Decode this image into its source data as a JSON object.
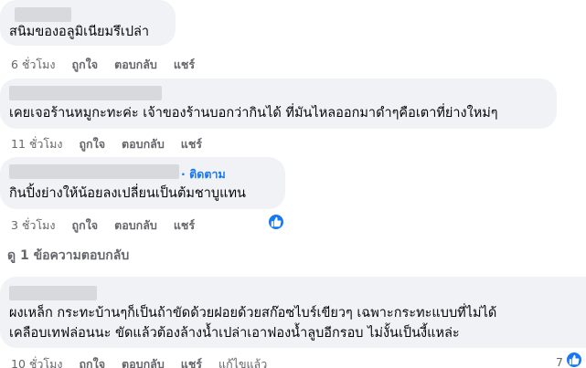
{
  "comments": [
    {
      "text": "สนิมของอลูมิเนียมรึเปล่า",
      "time": "6 ชั่วโมง",
      "like": "ถูกใจ",
      "reply": "ตอบกลับ",
      "share": "แชร์"
    },
    {
      "text": "เคยเจอร้านหมูกะทะค่ะ เจ้าของร้านบอกว่ากินได้ ที่มันไหลออกมาดำๆคือเตาที่ย่างใหม่ๆ",
      "time": "11 ชั่วโมง",
      "like": "ถูกใจ",
      "reply": "ตอบกลับ",
      "share": "แชร์"
    },
    {
      "follow_label": "· ติดตาม",
      "text": "กินปิ้งย่างให้น้อยลงเปลี่ยนเป็นต้มชาบูแทน",
      "time": "3 ชั่วโมง",
      "like": "ถูกใจ",
      "reply": "ตอบกลับ",
      "share": "แชร์",
      "reaction_icon": "thumbs-up-icon"
    },
    {
      "text_line1": "ผงเหล็ก กระทะบ้านๆก็เป็นถ้าขัดด้วยฝอยด้วยสก๊อซไบร์เขียวๆ เฉพาะกระทะแบบที่ไม่ได้",
      "text_line2": "เคลือบเทฟล่อนนะ ขัดแล้วต้องล้างน้ำเปล่าเอาฟองน้ำลูบอีกรอบ ไม่งั้นเป็นงี้แหล่ะ",
      "time": "10 ชั่วโมง",
      "like": "ถูกใจ",
      "reply": "ตอบกลับ",
      "share": "แชร์",
      "edited": "แก้ไขแล้ว",
      "reaction_count": "7",
      "reaction_icon": "thumbs-up-icon"
    }
  ],
  "view_replies": "ดู 1 ข้อความตอบกลับ",
  "colors": {
    "bubble": "#f0f2f5",
    "accent": "#1877f2",
    "meta": "#65676b"
  }
}
